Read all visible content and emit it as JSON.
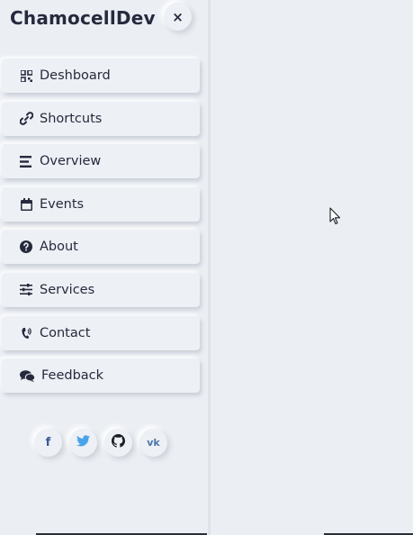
{
  "brand": {
    "title": "ChamocellDev"
  },
  "close_button": {
    "label": "×"
  },
  "menu": [
    {
      "label": "Deshboard",
      "icon": "dashboard-icon"
    },
    {
      "label": "Shortcuts",
      "icon": "link-icon"
    },
    {
      "label": "Overview",
      "icon": "list-icon"
    },
    {
      "label": "Events",
      "icon": "calendar-icon"
    },
    {
      "label": "About",
      "icon": "question-icon"
    },
    {
      "label": "Services",
      "icon": "sliders-icon"
    },
    {
      "label": "Contact",
      "icon": "phone-icon"
    },
    {
      "label": "Feedback",
      "icon": "comments-icon"
    }
  ],
  "socials": [
    {
      "label": "f",
      "icon": "facebook-icon",
      "color": "#3b5998"
    },
    {
      "label": "",
      "icon": "twitter-icon",
      "color": "#4aa3e8"
    },
    {
      "label": "",
      "icon": "github-icon",
      "color": "#1b1f23"
    },
    {
      "label": "vk",
      "icon": "vk-icon",
      "color": "#4a76a8"
    }
  ],
  "colors": {
    "background": "#ebeef3",
    "text": "#262a3d"
  }
}
